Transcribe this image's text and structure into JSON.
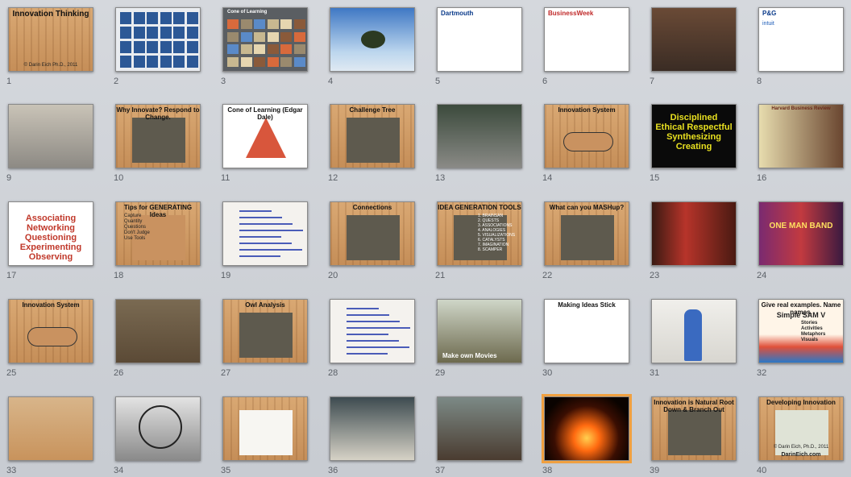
{
  "slides": [
    {
      "number": "1",
      "style": "wood",
      "title": "Innovation Thinking",
      "text": "© Darin Eich Ph.D., 2011"
    },
    {
      "number": "2",
      "style": "grid-blue"
    },
    {
      "number": "3",
      "style": "grid-photos",
      "title": "Cone of Learning"
    },
    {
      "number": "4",
      "style": "sky-tree"
    },
    {
      "number": "5",
      "style": "logos",
      "title": "Dartmouth"
    },
    {
      "number": "6",
      "style": "article",
      "title": "BusinessWeek"
    },
    {
      "number": "7",
      "style": "classroom"
    },
    {
      "number": "8",
      "style": "logos2",
      "title": "P&G",
      "text": "intuit"
    },
    {
      "number": "9",
      "style": "wall-photos"
    },
    {
      "number": "10",
      "style": "wood-photo",
      "title": "Why Innovate?  Respond to Change."
    },
    {
      "number": "11",
      "style": "pyramid",
      "title": "Cone of Learning (Edgar Dale)"
    },
    {
      "number": "12",
      "style": "wood-photo",
      "title": "Challenge Tree"
    },
    {
      "number": "13",
      "style": "hall"
    },
    {
      "number": "14",
      "style": "diagram",
      "title": "Innovation System"
    },
    {
      "number": "15",
      "style": "black-words",
      "title": "Disciplined Ethical Respectful Synthesizing Creating"
    },
    {
      "number": "16",
      "style": "books",
      "title": "Harvard Business Review"
    },
    {
      "number": "17",
      "style": "words",
      "title": "Associating Networking Questioning Experimenting Observing"
    },
    {
      "number": "18",
      "style": "wood-list",
      "title": "Tips for GENERATING Ideas",
      "items": [
        "Capture",
        "Quantity",
        "Questions",
        "Don't Judge",
        "Use Tools"
      ]
    },
    {
      "number": "19",
      "style": "notebook"
    },
    {
      "number": "20",
      "style": "wood-photo",
      "title": "Connections"
    },
    {
      "number": "21",
      "style": "wood-photo",
      "title": "IDEA GENERATION TOOLS",
      "items": [
        "1. BRAINSAN",
        "2. QUESTS",
        "3. ASSOCIATIONS",
        "4. ANALOGIES",
        "5. VISUALIZATIONS",
        "6. CATALYSTS",
        "7. IMAGINATION",
        "8. SCAMPER"
      ]
    },
    {
      "number": "22",
      "style": "wood-photo",
      "title": "What can you MASHup?"
    },
    {
      "number": "23",
      "style": "poster"
    },
    {
      "number": "24",
      "style": "poster2",
      "title": "ONE MAN BAND"
    },
    {
      "number": "25",
      "style": "diagram",
      "title": "Innovation System"
    },
    {
      "number": "26",
      "style": "ground"
    },
    {
      "number": "27",
      "style": "wood-photo",
      "title": "Owl Analysis"
    },
    {
      "number": "28",
      "style": "notebook2"
    },
    {
      "number": "29",
      "style": "forest",
      "title": "Make own Movies"
    },
    {
      "number": "30",
      "style": "stick",
      "title": "Making Ideas Stick"
    },
    {
      "number": "31",
      "style": "person"
    },
    {
      "number": "32",
      "style": "pencils",
      "title": "Give real examples. Name names.",
      "text": "Simple SAM V",
      "items": [
        "Stories",
        "Activities",
        "Metaphors",
        "Visuals"
      ]
    },
    {
      "number": "33",
      "style": "comic"
    },
    {
      "number": "34",
      "style": "ferris"
    },
    {
      "number": "35",
      "style": "wood-page"
    },
    {
      "number": "36",
      "style": "mammoth"
    },
    {
      "number": "37",
      "style": "mammoth2"
    },
    {
      "number": "38",
      "style": "fire"
    },
    {
      "number": "39",
      "style": "wood-photo",
      "title": "Innovation is Natural Root Down & Branch Out"
    },
    {
      "number": "40",
      "style": "wood-diagram",
      "title": "Developing Innovation",
      "text": "© Darin Eich, Ph.D., 2011",
      "items": [
        "DarinEich.com"
      ]
    }
  ],
  "selected_slide": "38",
  "colors": {
    "wood": "#c99260",
    "selection": "#f0a040",
    "background": "#cdd1d6"
  }
}
